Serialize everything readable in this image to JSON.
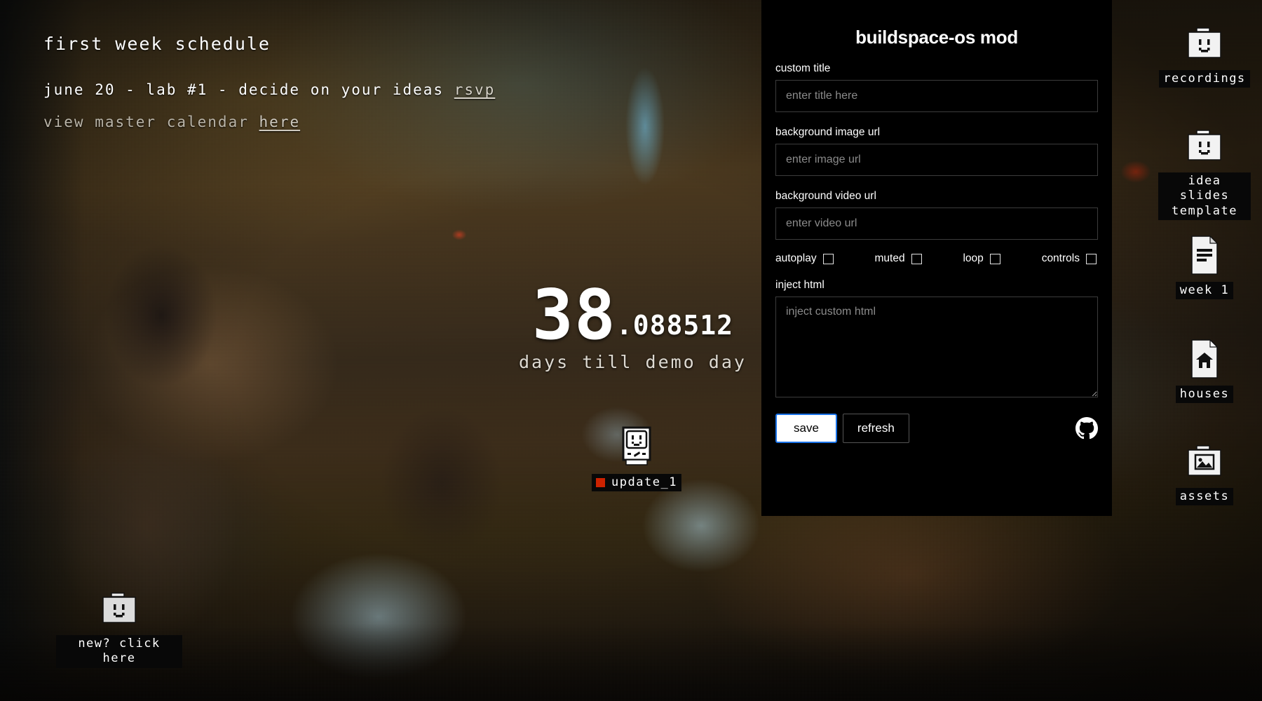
{
  "desktop": {
    "schedule": {
      "title": "first week schedule",
      "line1_text": "june 20 - lab #1 - decide on your ideas",
      "line1_link": "rsvp",
      "line2_text": "view master calendar",
      "line2_link": "here"
    },
    "countdown": {
      "days": "38",
      "fraction": ".088512",
      "caption": "days till demo day"
    },
    "icons": [
      {
        "id": "recordings",
        "label": "recordings",
        "glyph": "folder-smiley-icon"
      },
      {
        "id": "idea-slides",
        "label": "idea slides\ntemplate",
        "glyph": "folder-smiley-icon"
      },
      {
        "id": "week1",
        "label": "week 1",
        "glyph": "document-lines-icon"
      },
      {
        "id": "houses",
        "label": "houses",
        "glyph": "document-house-icon"
      },
      {
        "id": "assets",
        "label": "assets",
        "glyph": "folder-image-icon"
      },
      {
        "id": "new-here",
        "label": "new? click here",
        "glyph": "folder-smiley-icon"
      },
      {
        "id": "update1",
        "label": "update_1",
        "glyph": "happy-mac-icon"
      }
    ]
  },
  "mod_panel": {
    "title": "buildspace-os mod",
    "fields": {
      "custom_title": {
        "label": "custom title",
        "placeholder": "enter title here",
        "value": ""
      },
      "background_image_url": {
        "label": "background image url",
        "placeholder": "enter image url",
        "value": ""
      },
      "background_video_url": {
        "label": "background video url",
        "placeholder": "enter video url",
        "value": ""
      },
      "inject_html": {
        "label": "inject html",
        "placeholder": "inject custom html",
        "value": ""
      }
    },
    "video_flags": [
      {
        "label": "autoplay",
        "checked": false
      },
      {
        "label": "muted",
        "checked": false
      },
      {
        "label": "loop",
        "checked": false
      },
      {
        "label": "controls",
        "checked": false
      }
    ],
    "buttons": {
      "save": "save",
      "refresh": "refresh"
    },
    "github_icon": "github-icon"
  },
  "colors": {
    "panel_background": "#000000",
    "save_focus_ring": "#1a73e8",
    "status_dot": "#cc2200",
    "input_border": "#3c3c3c",
    "placeholder": "#8b8b8b"
  }
}
